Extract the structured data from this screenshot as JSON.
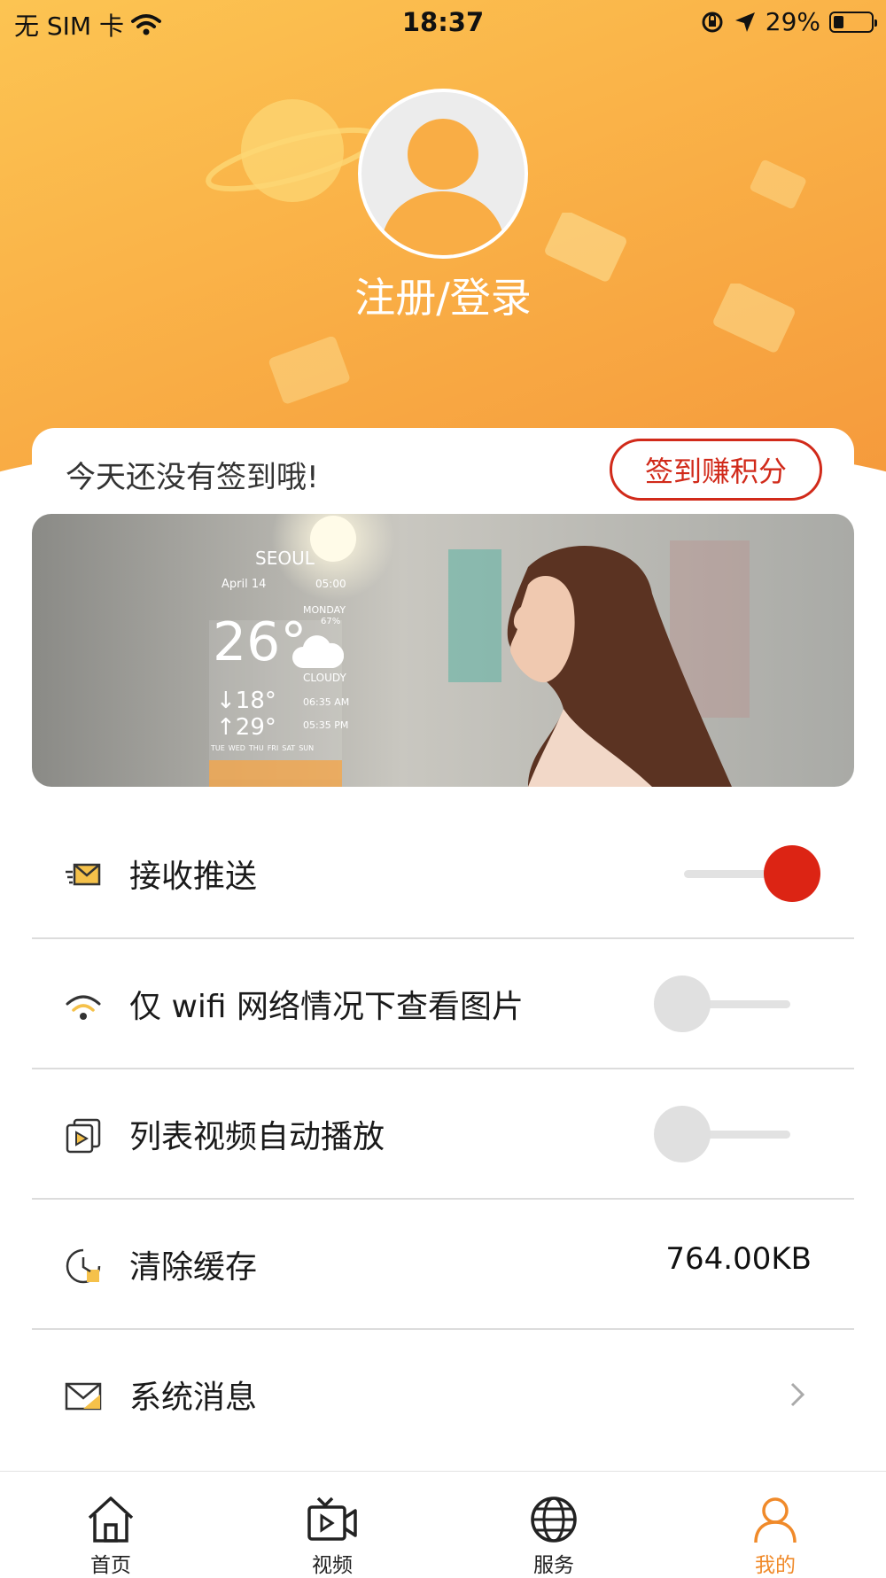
{
  "status_bar": {
    "carrier": "无 SIM 卡",
    "time": "18:37",
    "battery": "29%"
  },
  "profile": {
    "login_label": "注册/登录"
  },
  "checkin": {
    "message": "今天还没有签到哦!",
    "button_label": "签到赚积分"
  },
  "banner": {
    "city": "SEOUL",
    "date": "April 14",
    "clock": "05:00",
    "day": "MONDAY",
    "humidity": "67%",
    "temperature": "26°",
    "condition": "CLOUDY",
    "low": "↓18°",
    "high": "↑29°",
    "sunrise": "06:35 AM",
    "sunset": "05:35 PM",
    "days": [
      "TUE",
      "WED",
      "THU",
      "FRI",
      "SAT",
      "SUN"
    ]
  },
  "settings": [
    {
      "label": "接收推送",
      "icon": "envelope-send-icon",
      "toggle": true
    },
    {
      "label": "仅 wifi 网络情况下查看图片",
      "icon": "wifi-icon",
      "toggle": false
    },
    {
      "label": "列表视频自动播放",
      "icon": "video-list-icon",
      "toggle": false
    },
    {
      "label": "清除缓存",
      "icon": "clock-icon",
      "value": "764.00KB"
    },
    {
      "label": "系统消息",
      "icon": "mail-icon"
    }
  ],
  "tabs": [
    {
      "label": "首页",
      "icon": "home-icon"
    },
    {
      "label": "视频",
      "icon": "video-icon"
    },
    {
      "label": "服务",
      "icon": "globe-icon"
    },
    {
      "label": "我的",
      "icon": "person-icon",
      "active": true
    }
  ],
  "colors": {
    "accent_orange": "#f9ad45",
    "active_tab": "#f08a2a",
    "toggle_on": "#dc2414",
    "checkin_red": "#d12a1a"
  }
}
